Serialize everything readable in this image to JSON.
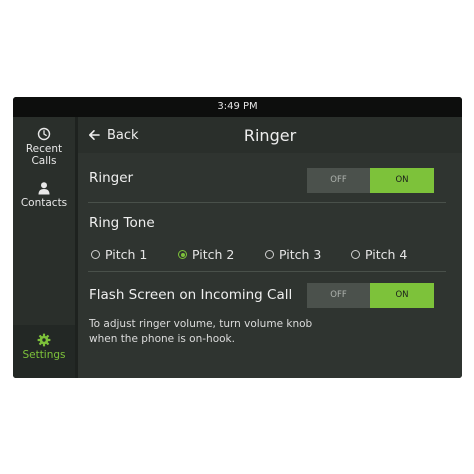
{
  "status_bar": {
    "time": "3:49 PM"
  },
  "sidebar": {
    "items": [
      {
        "label": "Recent Calls",
        "icon": "clock-icon"
      },
      {
        "label": "Contacts",
        "icon": "person-icon"
      },
      {
        "label": "Settings",
        "icon": "gear-icon",
        "active": true
      }
    ]
  },
  "header": {
    "back_label": "Back",
    "title": "Ringer"
  },
  "ringer": {
    "label": "Ringer",
    "off_label": "OFF",
    "on_label": "ON",
    "state": "on"
  },
  "ring_tone": {
    "label": "Ring Tone",
    "options": [
      "Pitch 1",
      "Pitch 2",
      "Pitch 3",
      "Pitch 4"
    ],
    "selected": "Pitch 2"
  },
  "flash_screen": {
    "label": "Flash Screen on Incoming Call",
    "off_label": "OFF",
    "on_label": "ON",
    "state": "on"
  },
  "hint": "To adjust ringer volume, turn volume knob when the phone is on-hook.",
  "colors": {
    "accent": "#7dc23a",
    "background": "#2f3430",
    "status_bar": "#0d0e0d"
  }
}
